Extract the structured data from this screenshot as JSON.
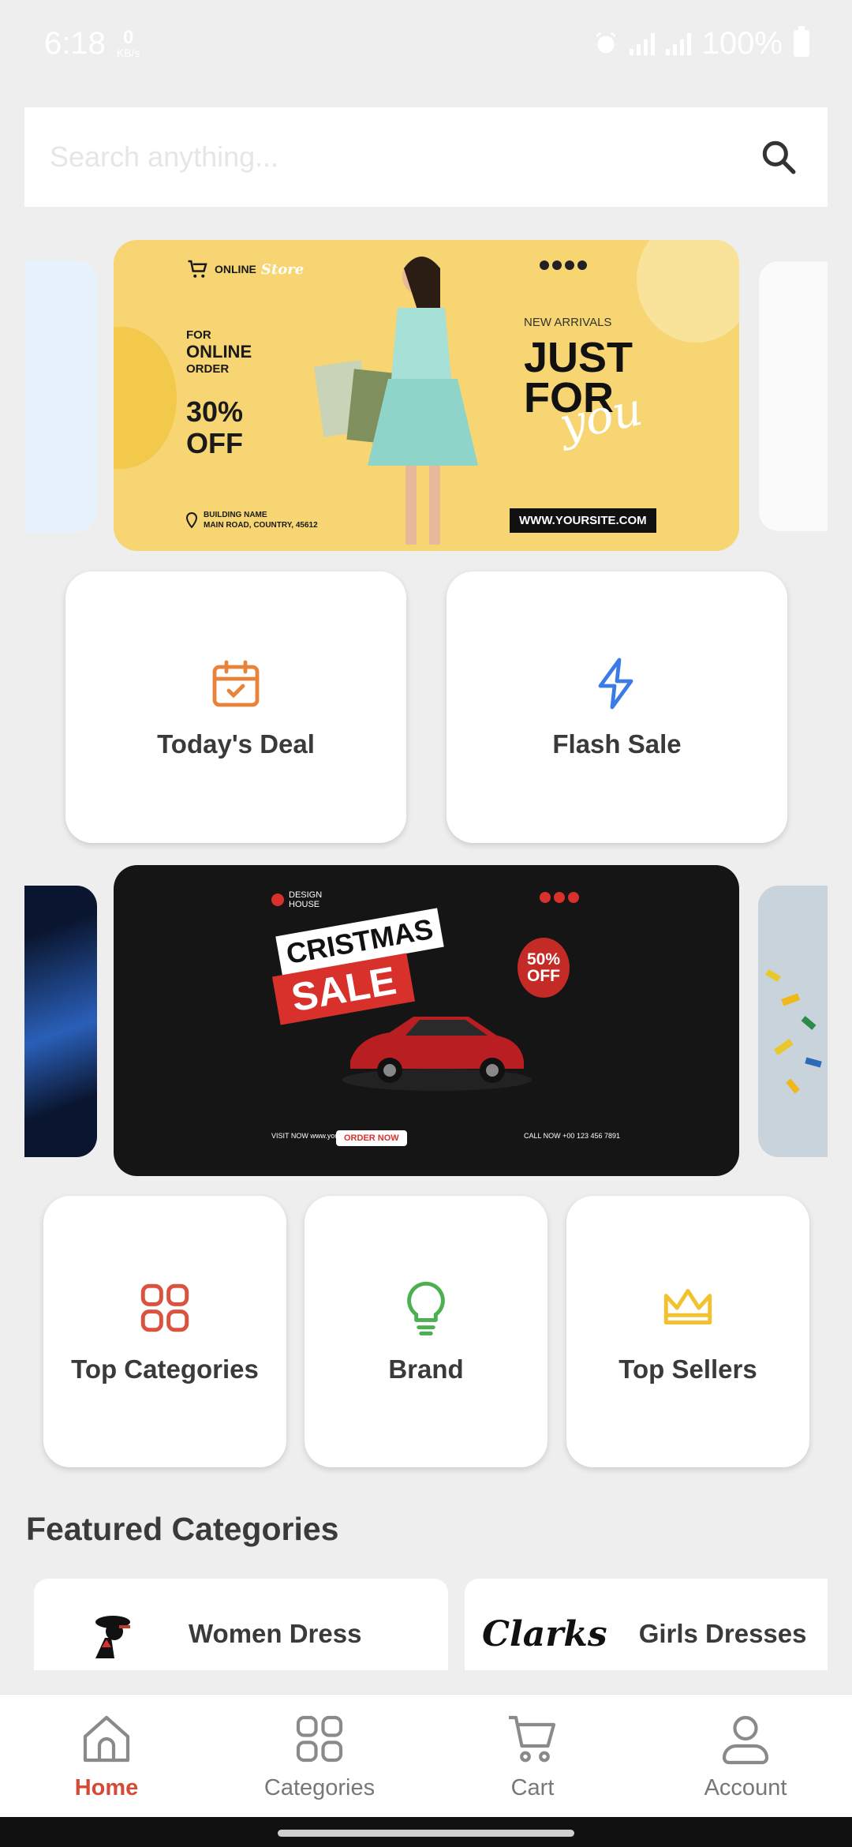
{
  "status_bar": {
    "time": "6:18",
    "net_speed": "0",
    "net_unit": "KB/s",
    "battery": "100%"
  },
  "search": {
    "placeholder": "Search anything..."
  },
  "banner_1": {
    "brand": "ONLINE",
    "brand_script": "Store",
    "for_line": "FOR",
    "online_line": "ONLINE",
    "order_line": "ORDER",
    "discount": "30%",
    "off": "OFF",
    "address_1": "BUILDING NAME",
    "address_2": "MAIN ROAD, COUNTRY, 45612",
    "new_arrivals": "NEW ARRIVALS",
    "just": "JUST",
    "for_word": "FOR",
    "you": "you",
    "site": "WWW.YOURSITE.COM"
  },
  "quick_actions_row1": [
    {
      "label": "Today's Deal",
      "icon": "calendar-check-icon",
      "color": "#e8833a"
    },
    {
      "label": "Flash Sale",
      "icon": "lightning-icon",
      "color": "#3a7be8"
    }
  ],
  "banner_2": {
    "design_1": "DESIGN",
    "design_2": "HOUSE",
    "cristmas": "CRISTMAS",
    "sale": "SALE",
    "pct": "50%",
    "off": "OFF",
    "order_now": "ORDER NOW",
    "visit": "VISIT NOW www.yourweb.com",
    "call": "CALL NOW +00 123 456 7891"
  },
  "quick_actions_row2": [
    {
      "label": "Top Categories",
      "icon": "categories-icon",
      "color": "#d9533f"
    },
    {
      "label": "Brand",
      "icon": "lightbulb-icon",
      "color": "#4caf50"
    },
    {
      "label": "Top Sellers",
      "icon": "crown-icon",
      "color": "#f2c12e"
    }
  ],
  "featured": {
    "title": "Featured Categories",
    "items": [
      {
        "name": "Women Dress"
      },
      {
        "name": "Girls Dresses",
        "logo_text": "Clarks"
      }
    ]
  },
  "bottom_nav": {
    "items": [
      {
        "label": "Home",
        "icon": "home-icon",
        "active": true
      },
      {
        "label": "Categories",
        "icon": "categories-icon"
      },
      {
        "label": "Cart",
        "icon": "cart-icon"
      },
      {
        "label": "Account",
        "icon": "account-icon"
      }
    ]
  },
  "colors": {
    "accent": "#d64a35",
    "background": "#eeeeee"
  }
}
